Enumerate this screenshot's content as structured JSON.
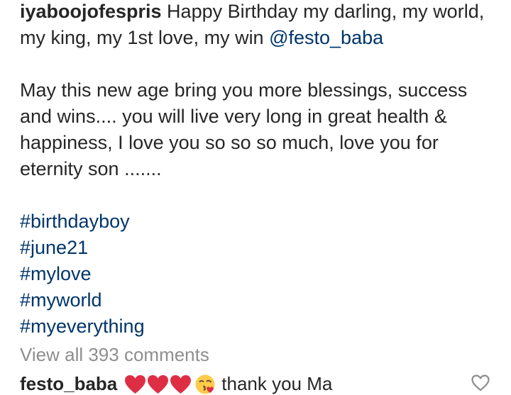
{
  "caption": {
    "username": "iyaboojofespris",
    "line1_text": " Happy Birthday my darling, my world,",
    "line2_text": "my king, my 1st love, my win ",
    "mention": "@festo_baba",
    "paragraph2": [
      "May this new age bring you more blessings, success",
      "and wins.... you will live very long in great health &",
      "happiness, I love you so so so much, love you for",
      "eternity son ......."
    ],
    "hashtags": [
      "#birthdayboy",
      "#june21",
      "#mylove",
      "#myworld",
      "#myeverything"
    ]
  },
  "comments": {
    "view_all_label": "View all 393 comments",
    "top_comment": {
      "username": "festo_baba",
      "emoji": [
        "red-heart",
        "red-heart",
        "red-heart",
        "face-blowing-kiss"
      ],
      "text": "thank you Ma"
    }
  },
  "icons": {
    "like": "heart-outline-icon"
  },
  "colors": {
    "text": "#262626",
    "link": "#003569",
    "muted": "#8e8e8e",
    "heart_emoji": "#dd2e44",
    "kiss_emoji": "#ffcb4c"
  }
}
